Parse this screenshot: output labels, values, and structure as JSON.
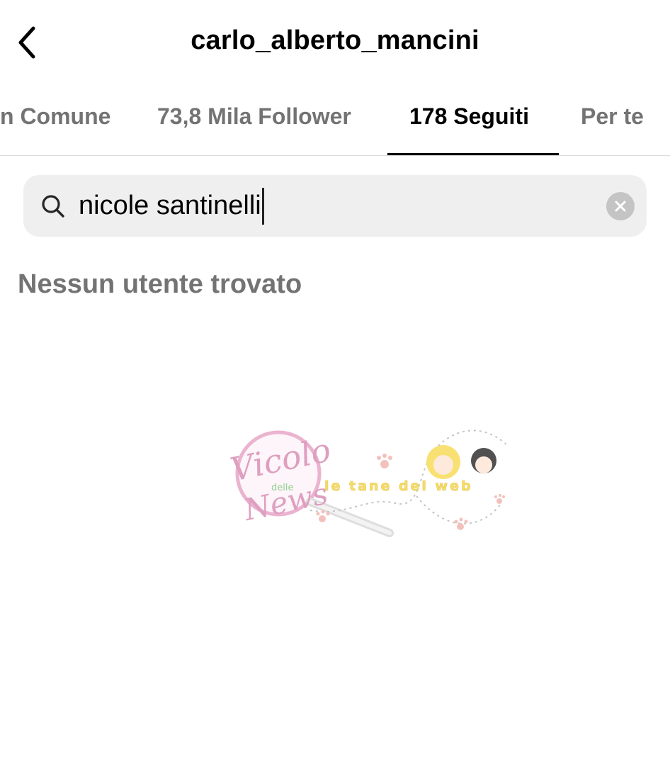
{
  "header": {
    "title": "carlo_alberto_mancini",
    "back_icon": "chevron-left-icon"
  },
  "tabs": [
    {
      "label": "n Comune",
      "active": false
    },
    {
      "label": "73,8 Mila Follower",
      "active": false
    },
    {
      "label": "178 Seguiti",
      "active": true
    },
    {
      "label": "Per te",
      "active": false
    }
  ],
  "search": {
    "icon": "search-icon",
    "value": "nicole santinelli",
    "clear_icon": "clear-icon"
  },
  "results": {
    "empty_message": "Nessun utente trovato"
  },
  "watermark": {
    "text_main": "Vicolo",
    "text_small": "delle",
    "text_news": "News",
    "text_tagline": "le tane del web"
  },
  "colors": {
    "text_primary": "#000000",
    "text_secondary": "#737373",
    "search_bg": "#efefef",
    "divider": "#dbdbdb",
    "watermark_pink": "#e8a6c8",
    "watermark_yellow": "#f5d84a"
  }
}
